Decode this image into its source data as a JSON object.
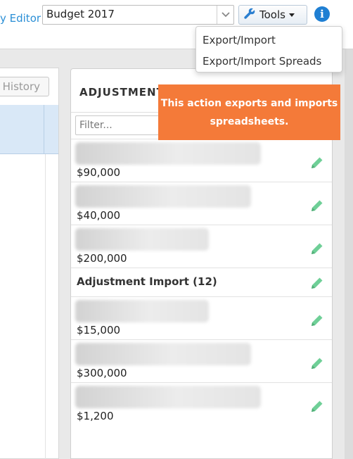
{
  "header": {
    "editor_link": "y Editor",
    "budget_select": {
      "value": "Budget 2017"
    },
    "tools_label": "Tools",
    "info_icon": "i"
  },
  "tools_menu": {
    "items": [
      {
        "label": "Export/Import"
      },
      {
        "label": "Export/Import Spreads"
      }
    ]
  },
  "left_panel": {
    "history_label": "History"
  },
  "adjustments": {
    "title": "ADJUSTMENT",
    "filter_placeholder": "Filter...",
    "items": [
      {
        "amount": "$90,000"
      },
      {
        "amount": "$40,000"
      },
      {
        "amount": "$200,000"
      },
      {
        "label": "Adjustment Import (12)"
      },
      {
        "amount": "$15,000"
      },
      {
        "amount": "$300,000"
      },
      {
        "amount": "$1,200"
      }
    ]
  },
  "tooltip": {
    "text": "This action exports and imports spreadsheets."
  },
  "colors": {
    "accent_blue": "#2b8fd6",
    "tooltip_orange": "#f47a39",
    "edit_icon_green": "#6fcf97"
  },
  "icons": {
    "tools": "wrench-icon",
    "info": "info-icon",
    "edit": "pencil-icon",
    "select_caret": "chevron-down-icon"
  }
}
